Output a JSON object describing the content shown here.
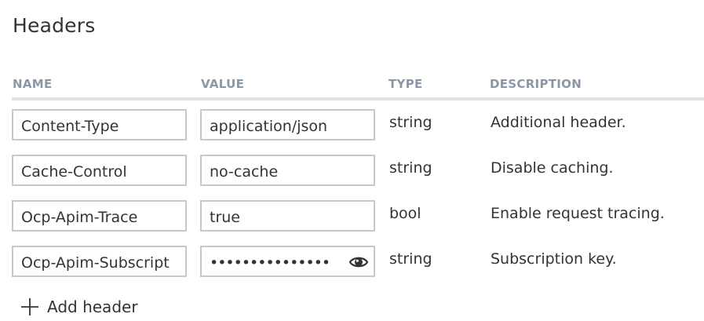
{
  "section": {
    "title": "Headers"
  },
  "columns": {
    "name": "NAME",
    "value": "VALUE",
    "type": "TYPE",
    "description": "DESCRIPTION"
  },
  "rows": [
    {
      "name": "Content-Type",
      "value": "application/json",
      "type": "string",
      "description": "Additional header."
    },
    {
      "name": "Cache-Control",
      "value": "no-cache",
      "type": "string",
      "description": "Disable caching."
    },
    {
      "name": "Ocp-Apim-Trace",
      "value": "true",
      "type": "bool",
      "description": "Enable request tracing."
    },
    {
      "name": "Ocp-Apim-Subscript",
      "value": "•••••••••••••••",
      "type": "string",
      "description": "Subscription key.",
      "masked": true,
      "reveal_icon": "eye-icon"
    }
  ],
  "actions": {
    "add_header_label": "Add header",
    "add_header_icon": "plus-icon"
  },
  "colors": {
    "header_text": "#8a97a6",
    "border": "#c8c8c8",
    "divider": "#e1e1e1",
    "text": "#333333"
  }
}
